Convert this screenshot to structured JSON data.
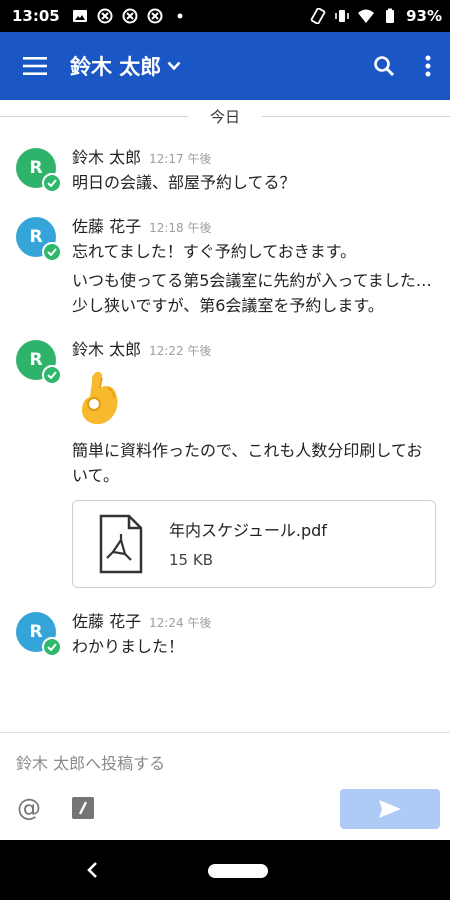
{
  "status_bar": {
    "time": "13:05",
    "battery": "93%"
  },
  "app_bar": {
    "title": "鈴木 太郎"
  },
  "date_separator": "今日",
  "messages": [
    {
      "avatar_letter": "R",
      "avatar_color": "#2fb36b",
      "sender": "鈴木 太郎",
      "time": "12:17 午後",
      "lines": [
        "明日の会議、部屋予約してる？"
      ]
    },
    {
      "avatar_letter": "R",
      "avatar_color": "#35a5d9",
      "sender": "佐藤 花子",
      "time": "12:18 午後",
      "lines": [
        "忘れてました！すぐ予約しておきます。",
        "いつも使ってる第5会議室に先約が入ってました…\n少し狭いですが、第6会議室を予約します。"
      ]
    },
    {
      "avatar_letter": "R",
      "avatar_color": "#2fb36b",
      "sender": "鈴木 太郎",
      "time": "12:22 午後",
      "emoji": "ok-hand-icon",
      "lines": [
        "簡単に資料作ったので、これも人数分印刷しておいて。"
      ],
      "attachment": {
        "name": "年内スケジュール.pdf",
        "size": "15 KB"
      }
    },
    {
      "avatar_letter": "R",
      "avatar_color": "#35a5d9",
      "sender": "佐藤 花子",
      "time": "12:24 午後",
      "lines": [
        "わかりました！"
      ]
    }
  ],
  "composer": {
    "placeholder": "鈴木 太郎へ投稿する"
  },
  "colors": {
    "app_bar": "#1a56c4",
    "send_button": "#aecbf5",
    "online_badge": "#2eb86b"
  }
}
